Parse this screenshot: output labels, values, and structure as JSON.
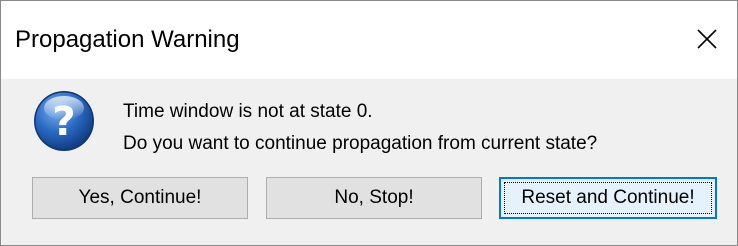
{
  "window": {
    "title": "Propagation Warning",
    "close_icon": "close-icon"
  },
  "message": {
    "icon": "question-icon",
    "line1": "Time window is not at state 0.",
    "line2": "Do you want to continue propagation from current state?"
  },
  "buttons": {
    "yes_label": "Yes, Continue!",
    "no_label": "No, Stop!",
    "reset_label": "Reset and Continue!"
  },
  "colors": {
    "icon_blue": "#1f5fb8",
    "focus_border": "#0078d7",
    "dialog_bg": "#f0f0f0"
  }
}
